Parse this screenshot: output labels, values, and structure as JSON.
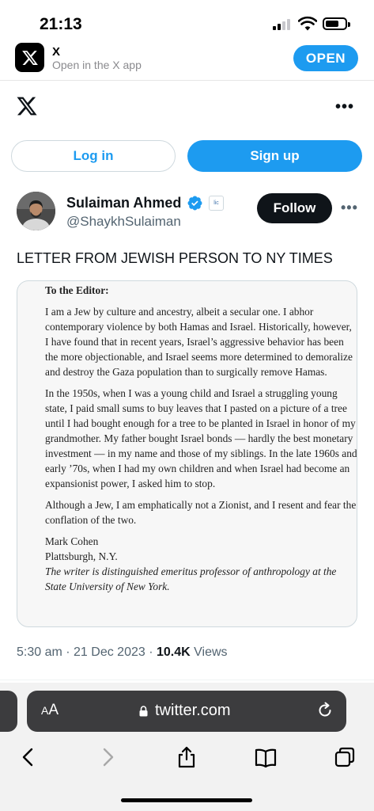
{
  "status_bar": {
    "time": "21:13"
  },
  "app_banner": {
    "app_name": "X",
    "subtitle": "Open in the X app",
    "open_label": "OPEN"
  },
  "auth": {
    "login_label": "Log in",
    "signup_label": "Sign up"
  },
  "tweet": {
    "author_name": "Sulaiman Ahmed",
    "handle": "@ShaykhSulaiman",
    "follow_label": "Follow",
    "text": "LETTER FROM JEWISH PERSON TO NY TIMES",
    "time": "5:30 am · 21 Dec 2023 · ",
    "views_count": "10.4K",
    "views_label": "Views",
    "affiliate_badge": "lic"
  },
  "letter": {
    "salutation": "To the Editor:",
    "paragraphs": [
      "I am a Jew by culture and ancestry, albeit a secular one. I abhor contemporary violence by both Hamas and Israel. Historically, however, I have found that in recent years, Israel’s aggressive behavior has been the more objectionable, and Israel seems more determined to demoralize and destroy the Gaza population than to surgically remove Hamas.",
      "In the 1950s, when I was a young child and Israel a struggling young state, I paid small sums to buy leaves that I pasted on a picture of a tree until I had bought enough for a tree to be planted in Israel in honor of my grandmother. My father bought Israel bonds — hardly the best monetary investment — in my name and those of my siblings. In the late 1960s and early ’70s, when I had my own children and when Israel had become an expansionist power, I asked him to stop.",
      "Although a Jew, I am emphatically not a Zionist, and I resent and fear the conflation of the two."
    ],
    "signature_name": "Mark Cohen",
    "signature_location": "Plattsburgh, N.Y.",
    "signature_note": "The writer is distinguished emeritus professor of anthropology at the State University of New York."
  },
  "browser": {
    "aa_label_small": "A",
    "aa_label_large": "A",
    "url": "twitter.com"
  },
  "colors": {
    "accent": "#1d9bf0",
    "dark": "#0f1419",
    "muted": "#536471"
  },
  "icons": [
    "signal-icon",
    "wifi-icon",
    "battery-icon",
    "x-logo-icon",
    "more-icon",
    "verified-badge-icon",
    "lock-icon",
    "reload-icon",
    "back-icon",
    "forward-icon",
    "share-icon",
    "bookmarks-icon",
    "tabs-icon"
  ]
}
